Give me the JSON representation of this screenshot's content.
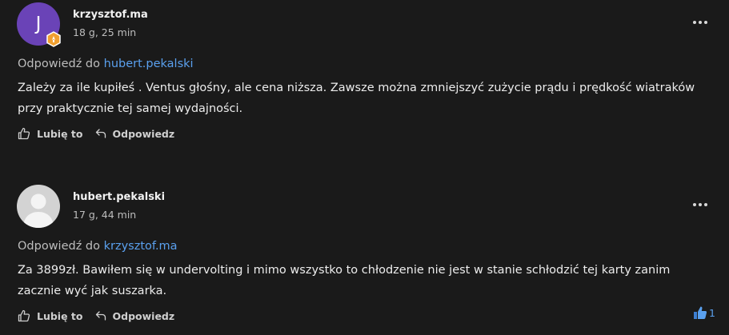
{
  "comments": [
    {
      "avatar_letter": "J",
      "avatar_color": "#6a43b7",
      "badge_color": "#f0a030",
      "author": "krzysztof.ma",
      "time": "18 g, 25 min",
      "reply_prefix": "Odpowiedź do",
      "reply_to": "hubert.pekalski",
      "body": "Zależy za ile kupiłeś . Ventus głośny, ale cena niższa. Zawsze można zmniejszyć zużycie prądu i prędkość wiatraków przy praktycznie tej samej wydajności.",
      "like_label": "Lubię to",
      "reply_label": "Odpowiedz"
    },
    {
      "avatar_color": "#d3d3d3",
      "author": "hubert.pekalski",
      "time": "17 g, 44 min",
      "reply_prefix": "Odpowiedź do",
      "reply_to": "krzysztof.ma",
      "body": "Za 3899zł. Bawiłem się w undervolting i mimo wszystko to chłodzenie nie jest w stanie schłodzić tej karty zanim zacznie wyć jak suszarka.",
      "like_label": "Lubię to",
      "reply_label": "Odpowiedz",
      "reaction_count": "1",
      "reaction_icon": "thumbs-up-icon"
    }
  ],
  "icons": {
    "more": "more-options-icon",
    "like": "thumbs-up-outline-icon",
    "reply": "reply-arrow-icon"
  }
}
